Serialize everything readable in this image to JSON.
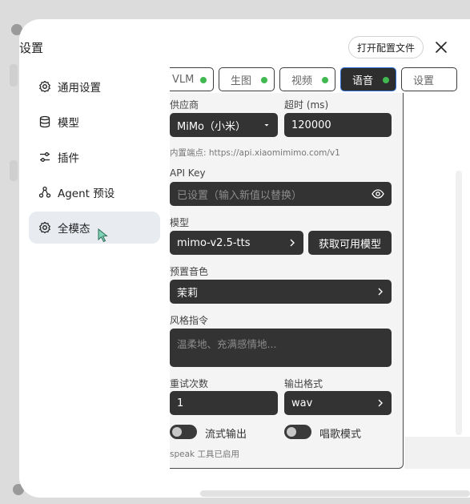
{
  "modal": {
    "title": "设置",
    "open_config_label": "打开配置文件"
  },
  "sidebar": {
    "items": [
      {
        "label": "通用设置",
        "icon": "gear-icon"
      },
      {
        "label": "模型",
        "icon": "database-icon"
      },
      {
        "label": "插件",
        "icon": "sliders-icon"
      },
      {
        "label": "Agent 预设",
        "icon": "agent-icon"
      },
      {
        "label": "全模态",
        "icon": "gear-icon",
        "active": true
      }
    ]
  },
  "tabs": [
    {
      "label": "VLM",
      "status": "enabled"
    },
    {
      "label": "生图",
      "status": "enabled"
    },
    {
      "label": "视频",
      "status": "enabled"
    },
    {
      "label": "语音",
      "status": "enabled",
      "active": true
    },
    {
      "label": "设置"
    }
  ],
  "form": {
    "provider_label": "供应商",
    "provider_value": "MiMo（小米）",
    "timeout_label": "超时 (ms)",
    "timeout_value": "120000",
    "endpoint_hint": "内置端点: https://api.xiaomimimo.com/v1",
    "api_key_label": "API Key",
    "api_key_placeholder": "已设置（输入新值以替换）",
    "model_label": "模型",
    "model_value": "mimo-v2.5-tts",
    "fetch_models_label": "获取可用模型",
    "voice_label": "预置音色",
    "voice_value": "茉莉",
    "style_label": "风格指令",
    "style_placeholder": "温柔地、充满感情地...",
    "retry_label": "重试次数",
    "retry_value": "1",
    "format_label": "输出格式",
    "format_value": "wav",
    "stream_label": "流式输出",
    "stream_on": false,
    "singing_label": "唱歌模式",
    "singing_on": false,
    "footer_hint": "speak 工具已启用"
  },
  "colors": {
    "status_green": "#3fb950",
    "active_tab_border": "#2f6fd6",
    "field_bg": "#333333",
    "sidebar_active_bg": "#e8ecf1"
  }
}
